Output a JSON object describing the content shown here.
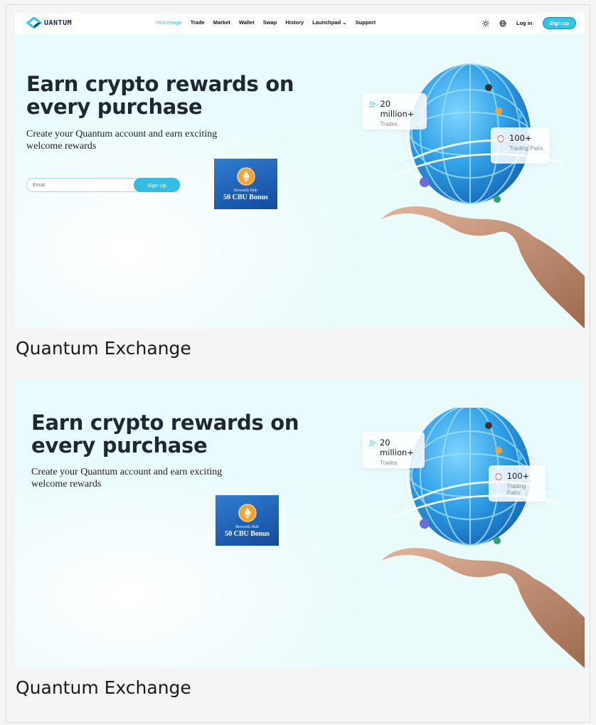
{
  "nav": {
    "logo_text": "UANTUM",
    "links": [
      {
        "label": "Homepage",
        "active": true
      },
      {
        "label": "Trade"
      },
      {
        "label": "Market"
      },
      {
        "label": "Wallet"
      },
      {
        "label": "Swap"
      },
      {
        "label": "History"
      },
      {
        "label": "Launchpad"
      },
      {
        "label": "Support"
      }
    ],
    "login": "Log in",
    "signup": "Sign up"
  },
  "hero": {
    "headline_line1": "Earn crypto rewards on",
    "headline_line2": "every purchase",
    "subtext": "Create your Quantum account and earn exciting welcome rewards",
    "email_placeholder": "Email",
    "signup_button": "Sign Up",
    "rewards": {
      "title": "Rewards Hub",
      "bonus": "50 CBU Bonus"
    },
    "stats": [
      {
        "value": "20 million+",
        "label": "Trades"
      },
      {
        "value": "100+",
        "label": "Trading Pairs"
      }
    ]
  },
  "captions": [
    "Quantum Exchange",
    "Quantum Exchange"
  ],
  "colors": {
    "accent": "#2fc7e6",
    "text_dark": "#1f2730",
    "rewards_blue": "#1a5bb0"
  }
}
